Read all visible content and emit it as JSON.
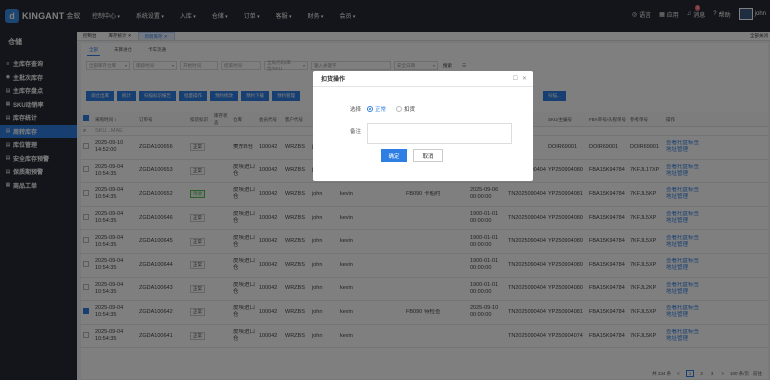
{
  "header": {
    "logo_mark": "d",
    "logo_text": "KINGANT",
    "logo_sub": "金蚁",
    "nav": [
      "控制中心",
      "系统设置",
      "入库",
      "仓储",
      "订单",
      "客服",
      "财务",
      "会员"
    ],
    "language": "语言",
    "apps": "应用",
    "messages": "消息",
    "messages_count": "4",
    "help": "帮助",
    "user": "john"
  },
  "sidebar": {
    "title": "仓储",
    "items": [
      {
        "label": "主库存查询",
        "icon": "≡"
      },
      {
        "label": "主批次库存",
        "icon": "◉"
      },
      {
        "label": "主库存盘点",
        "icon": "▤"
      },
      {
        "label": "SKU动销率",
        "icon": "▦"
      },
      {
        "label": "库存统计",
        "icon": "▤"
      },
      {
        "label": "周转库存",
        "icon": "▤"
      },
      {
        "label": "库位管理",
        "icon": "▤"
      },
      {
        "label": "安全库存预警",
        "icon": "▤"
      },
      {
        "label": "保质期预警",
        "icon": "▤"
      },
      {
        "label": "商品工单",
        "icon": "▦"
      }
    ],
    "active_index": 5
  },
  "tabs": {
    "items": [
      "控制台",
      "库存统计 ✕",
      "周转库存 ✕"
    ],
    "active_index": 2,
    "close_all": "全部关闭"
  },
  "subtabs": {
    "items": [
      "全部",
      "未算进仓",
      "卡车流通"
    ],
    "active_index": 0
  },
  "filters": {
    "f1": "全部库存仓库",
    "f2": "库龄时间",
    "f3": "开始时间",
    "f4": "结束时间",
    "f5": "全局代码/库位/SKU",
    "f6": "输入关键字",
    "f7": "安全日期",
    "search": "搜索"
  },
  "action_buttons": [
    "调仓出库",
    "统计",
    "扫描标识报告",
    "批量操作",
    "预约修改",
    "预约下载",
    "预约管理",
    "扫描..."
  ],
  "table": {
    "headers": [
      "",
      "采购时间 ↕",
      "订单号",
      "扣货标识",
      "库存状态",
      "仓库",
      "会员代号",
      "客户代号",
      "...",
      "...",
      "...",
      "...",
      "...",
      "...",
      "预约时间",
      "采购单",
      "SKU/主编号",
      "FBA单号/头程单号",
      "参考单号",
      "操作"
    ],
    "filter_placeholder": "SKU...MAE",
    "rows": [
      {
        "date": "2025-09-10",
        "time": "14:52:00",
        "order": "ZGDA100656",
        "flag": "正常",
        "flag_style": "",
        "warehouse": "美东B仓",
        "member": "100042",
        "client": "WRZBS",
        "c8": "jo",
        "c9": "",
        "c10": "",
        "c11": "",
        "c12": "",
        "pre_time": "",
        "po": "DG90001",
        "sku": "DOIR69001",
        "fba": "DOIR69001",
        "ref": "DOIR69001",
        "op1": "查看托盘标签",
        "op2": "地址管理",
        "checked": false
      },
      {
        "date": "2025-09-04",
        "time": "10:54:35",
        "order": "ZGDA100653",
        "flag": "正常",
        "flag_style": "",
        "warehouse": "皮埃进口仓",
        "member": "100042",
        "client": "WRZBS",
        "c8": "jo",
        "c9": "",
        "c10": "",
        "c11": "",
        "c12": "",
        "pre_time": "",
        "po": "TN2025090404",
        "sku": "YP250904080",
        "fba": "FBA15K94784",
        "ref": "7KFJL17XP",
        "op1": "查看托盘标签",
        "op2": "地址管理",
        "checked": false
      },
      {
        "date": "2025-09-04",
        "time": "10:54:35",
        "order": "ZGDA100652",
        "flag": "待收",
        "flag_style": "green",
        "warehouse": "皮埃进口仓",
        "member": "100042",
        "client": "WRZBS",
        "c8": "john",
        "c9": "kevin",
        "c10": "",
        "c11": "FB090402",
        "c12": "",
        "pre_time": "2025-09-06 00:00:00",
        "pre_status": "卡船约",
        "po": "TN2025090404",
        "sku": "YP250904081",
        "fba": "FBA15K94784",
        "ref": "7KFJL5KP",
        "op1": "查看托盘标签",
        "op2": "地址管理",
        "checked": false
      },
      {
        "date": "2025-09-04",
        "time": "10:54:35",
        "order": "ZGDA100646",
        "flag": "正常",
        "flag_style": "",
        "warehouse": "皮埃进口仓",
        "member": "100042",
        "client": "WRZBS",
        "c8": "john",
        "c9": "kevin",
        "c10": "",
        "c11": "",
        "c12": "",
        "pre_time": "1900-01-01 00:00:00",
        "pre_status": "",
        "po": "TN2025090404",
        "sku": "YP250904080",
        "fba": "FBA15K94784",
        "ref": "7KFJL5XP",
        "op1": "查看托盘标签",
        "op2": "地址管理",
        "checked": false
      },
      {
        "date": "2025-09-04",
        "time": "10:54:35",
        "order": "ZGDA100645",
        "flag": "正常",
        "flag_style": "",
        "warehouse": "皮埃进口仓",
        "member": "100042",
        "client": "WRZBS",
        "c8": "john",
        "c9": "kevin",
        "c10": "",
        "c11": "",
        "c12": "",
        "pre_time": "1900-01-01 00:00:00",
        "pre_status": "",
        "po": "TN2025090404",
        "sku": "YP250904080",
        "fba": "FBA15K94784",
        "ref": "7KFJL5XP",
        "op1": "查看托盘标签",
        "op2": "地址管理",
        "checked": false
      },
      {
        "date": "2025-09-04",
        "time": "10:54:35",
        "order": "ZGDA100644",
        "flag": "正常",
        "flag_style": "",
        "warehouse": "皮埃进口仓",
        "member": "100042",
        "client": "WRZBS",
        "c8": "john",
        "c9": "kevin",
        "c10": "",
        "c11": "",
        "c12": "",
        "pre_time": "1900-01-01 00:00:00",
        "pre_status": "",
        "po": "TN2025090404",
        "sku": "YP250904080",
        "fba": "FBA15K94784",
        "ref": "7KFJL5XP",
        "op1": "查看托盘标签",
        "op2": "地址管理",
        "checked": false
      },
      {
        "date": "2025-09-04",
        "time": "10:54:35",
        "order": "ZGDA100643",
        "flag": "正常",
        "flag_style": "",
        "warehouse": "皮埃进口仓",
        "member": "100042",
        "client": "WRZBS",
        "c8": "john",
        "c9": "kevin",
        "c10": "",
        "c11": "",
        "c12": "",
        "pre_time": "1900-01-01 00:00:00",
        "pre_status": "",
        "po": "TN2025090404",
        "sku": "YP250904080",
        "fba": "FBA15K94784",
        "ref": "7KFJL2KP",
        "op1": "查看托盘标签",
        "op2": "地址管理",
        "checked": false
      },
      {
        "date": "2025-09-04",
        "time": "10:54:35",
        "order": "ZGDA100642",
        "flag": "正常",
        "flag_style": "",
        "warehouse": "皮埃进口仓",
        "member": "100042",
        "client": "WRZBS",
        "c8": "john",
        "c9": "kevin",
        "c10": "",
        "c11": "FB090401",
        "c12": "",
        "pre_time": "2025-09-10 00:00:00",
        "pre_status": "待检查",
        "po": "TN2025090404",
        "sku": "YP250904081",
        "fba": "FBA15K94784",
        "ref": "7KFJL5XP",
        "op1": "查看托盘标签",
        "op2": "地址管理",
        "checked": true
      },
      {
        "date": "2025-09-04",
        "time": "10:54:35",
        "order": "ZGDA100641",
        "flag": "正常",
        "flag_style": "",
        "warehouse": "皮埃进口仓",
        "member": "100042",
        "client": "WRZBS",
        "c8": "john",
        "c9": "kevin",
        "c10": "",
        "c11": "",
        "c12": "",
        "pre_time": "",
        "pre_status": "",
        "po": "TN2025090404",
        "sku": "YP250904074",
        "fba": "FBA15K94784",
        "ref": "7KFJL5KP",
        "op1": "查看托盘标签",
        "op2": "地址管理",
        "checked": false
      }
    ]
  },
  "pager": {
    "total": "共 234 条",
    "pages": [
      "<",
      "1",
      "2",
      "3",
      ">"
    ],
    "active": "1",
    "size": "100 条/页",
    "goto": "前往"
  },
  "modal": {
    "title": "扣货操作",
    "choose_label": "选择",
    "option_normal": "正常",
    "option_hold": "扣货",
    "remark_label": "备注",
    "confirm": "确定",
    "cancel": "取消"
  }
}
